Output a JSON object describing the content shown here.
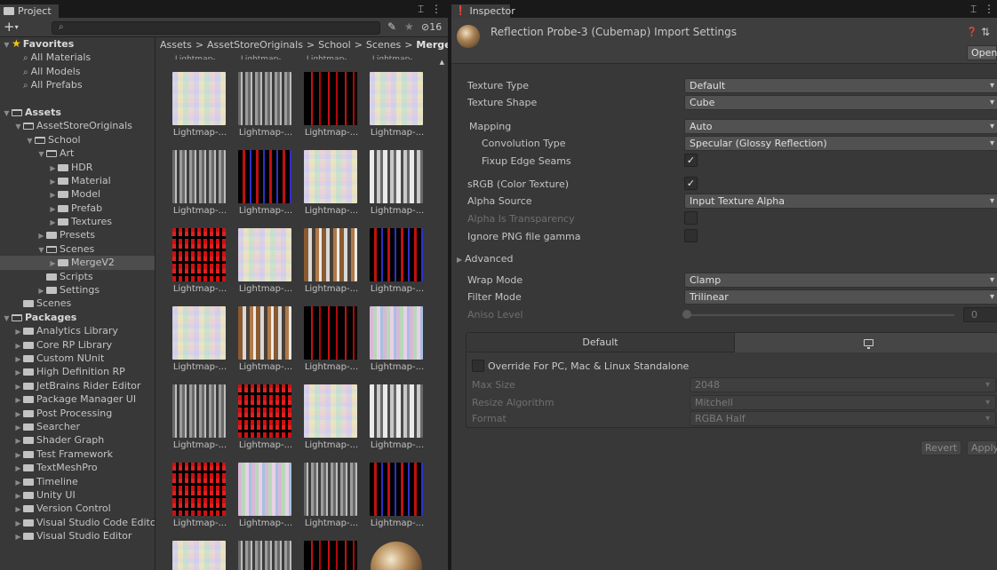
{
  "project": {
    "tab_label": "Project",
    "tab_menu": "⌶ ⋮",
    "toolbar": {
      "plus_label": "+",
      "plus_caret": "▾",
      "search_placeholder": "",
      "search_icon": "⌕",
      "hidden_count": "16"
    },
    "tree": [
      {
        "label": "Favorites",
        "level": 0,
        "kind": "favorites",
        "arrow": "▼",
        "bold": true
      },
      {
        "label": "All Materials",
        "level": 1,
        "kind": "search"
      },
      {
        "label": "All Models",
        "level": 1,
        "kind": "search"
      },
      {
        "label": "All Prefabs",
        "level": 1,
        "kind": "search"
      },
      {
        "label": "",
        "level": 0,
        "kind": "blank"
      },
      {
        "label": "Assets",
        "level": 0,
        "kind": "folder-open",
        "arrow": "▼",
        "bold": true
      },
      {
        "label": "AssetStoreOriginals",
        "level": 1,
        "kind": "folder-open",
        "arrow": "▼"
      },
      {
        "label": "School",
        "level": 2,
        "kind": "folder-open",
        "arrow": "▼"
      },
      {
        "label": "Art",
        "level": 3,
        "kind": "folder-open",
        "arrow": "▼"
      },
      {
        "label": "HDR",
        "level": 4,
        "kind": "folder",
        "arrow": "▶"
      },
      {
        "label": "Material",
        "level": 4,
        "kind": "folder",
        "arrow": "▶"
      },
      {
        "label": "Model",
        "level": 4,
        "kind": "folder",
        "arrow": "▶"
      },
      {
        "label": "Prefab",
        "level": 4,
        "kind": "folder",
        "arrow": "▶"
      },
      {
        "label": "Textures",
        "level": 4,
        "kind": "folder",
        "arrow": "▶"
      },
      {
        "label": "Presets",
        "level": 3,
        "kind": "folder",
        "arrow": "▶"
      },
      {
        "label": "Scenes",
        "level": 3,
        "kind": "folder-open",
        "arrow": "▼"
      },
      {
        "label": "MergeV2",
        "level": 4,
        "kind": "folder",
        "arrow": "▶",
        "selected": true
      },
      {
        "label": "Scripts",
        "level": 3,
        "kind": "folder"
      },
      {
        "label": "Settings",
        "level": 3,
        "kind": "folder",
        "arrow": "▶"
      },
      {
        "label": "Scenes",
        "level": 1,
        "kind": "folder"
      },
      {
        "label": "Packages",
        "level": 0,
        "kind": "folder-open",
        "arrow": "▼",
        "bold": true
      },
      {
        "label": "Analytics Library",
        "level": 1,
        "kind": "folder",
        "arrow": "▶"
      },
      {
        "label": "Core RP Library",
        "level": 1,
        "kind": "folder",
        "arrow": "▶"
      },
      {
        "label": "Custom NUnit",
        "level": 1,
        "kind": "folder",
        "arrow": "▶"
      },
      {
        "label": "High Definition RP",
        "level": 1,
        "kind": "folder",
        "arrow": "▶"
      },
      {
        "label": "JetBrains Rider Editor",
        "level": 1,
        "kind": "folder",
        "arrow": "▶"
      },
      {
        "label": "Package Manager UI",
        "level": 1,
        "kind": "folder",
        "arrow": "▶"
      },
      {
        "label": "Post Processing",
        "level": 1,
        "kind": "folder",
        "arrow": "▶"
      },
      {
        "label": "Searcher",
        "level": 1,
        "kind": "folder",
        "arrow": "▶"
      },
      {
        "label": "Shader Graph",
        "level": 1,
        "kind": "folder",
        "arrow": "▶"
      },
      {
        "label": "Test Framework",
        "level": 1,
        "kind": "folder",
        "arrow": "▶"
      },
      {
        "label": "TextMeshPro",
        "level": 1,
        "kind": "folder",
        "arrow": "▶"
      },
      {
        "label": "Timeline",
        "level": 1,
        "kind": "folder",
        "arrow": "▶"
      },
      {
        "label": "Unity UI",
        "level": 1,
        "kind": "folder",
        "arrow": "▶"
      },
      {
        "label": "Version Control",
        "level": 1,
        "kind": "folder",
        "arrow": "▶"
      },
      {
        "label": "Visual Studio Code Editc",
        "level": 1,
        "kind": "folder",
        "arrow": "▶"
      },
      {
        "label": "Visual Studio Editor",
        "level": 1,
        "kind": "folder",
        "arrow": "▶"
      }
    ],
    "breadcrumb": {
      "parts": [
        "Assets",
        "AssetStoreOriginals",
        "School",
        "Scenes"
      ],
      "separator": ">",
      "last": "Merge"
    },
    "top_cut_label": "Lightmap-...",
    "thumbnails": [
      {
        "label": "Lightmap-...",
        "texture": "pastel"
      },
      {
        "label": "Lightmap-...",
        "texture": "gray"
      },
      {
        "label": "Lightmap-...",
        "texture": "redsparse"
      },
      {
        "label": "Lightmap-...",
        "texture": "pastel"
      },
      {
        "label": "Lightmap-...",
        "texture": "gray"
      },
      {
        "label": "Lightmap-...",
        "texture": "blue"
      },
      {
        "label": "Lightmap-...",
        "texture": "pastel"
      },
      {
        "label": "Lightmap-...",
        "texture": "mix"
      },
      {
        "label": "Lightmap-...",
        "texture": "red"
      },
      {
        "label": "Lightmap-...",
        "texture": "pastel"
      },
      {
        "label": "Lightmap-...",
        "texture": "rust"
      },
      {
        "label": "Lightmap-...",
        "texture": "blue"
      },
      {
        "label": "Lightmap-...",
        "texture": "pastel"
      },
      {
        "label": "Lightmap-...",
        "texture": "rust"
      },
      {
        "label": "Lightmap-...",
        "texture": "redsparse"
      },
      {
        "label": "Lightmap-...",
        "texture": "pink"
      },
      {
        "label": "Lightmap-...",
        "texture": "gray"
      },
      {
        "label": "Lightmap-...",
        "texture": "red"
      },
      {
        "label": "Lightmap-...",
        "texture": "pastel"
      },
      {
        "label": "Lightmap-...",
        "texture": "mix"
      },
      {
        "label": "Lightmap-...",
        "texture": "red"
      },
      {
        "label": "Lightmap-...",
        "texture": "pink"
      },
      {
        "label": "Lightmap-...",
        "texture": "gray"
      },
      {
        "label": "Lightmap-...",
        "texture": "blue"
      },
      {
        "label": "",
        "texture": "pastel"
      },
      {
        "label": "",
        "texture": "gray"
      },
      {
        "label": "",
        "texture": "redsparse"
      },
      {
        "label": "",
        "texture": "sphere"
      }
    ]
  },
  "inspector": {
    "tab_label": "Inspector",
    "tab_menu": "⌶ ⋮",
    "title": "Reflection Probe-3 (Cubemap) Import Settings",
    "open_label": "Open",
    "properties": {
      "texture_type": {
        "label": "Texture Type",
        "value": "Default"
      },
      "texture_shape": {
        "label": "Texture Shape",
        "value": "Cube"
      },
      "mapping": {
        "label": "Mapping",
        "value": "Auto"
      },
      "convolution_type": {
        "label": "Convolution Type",
        "value": "Specular (Glossy Reflection)"
      },
      "fixup_edge_seams": {
        "label": "Fixup Edge Seams",
        "checked": true
      },
      "srgb": {
        "label": "sRGB (Color Texture)",
        "checked": true
      },
      "alpha_source": {
        "label": "Alpha Source",
        "value": "Input Texture Alpha"
      },
      "alpha_is_transparency": {
        "label": "Alpha Is Transparency",
        "checked": false,
        "disabled": true
      },
      "ignore_png_gamma": {
        "label": "Ignore PNG file gamma",
        "checked": false
      },
      "advanced": {
        "label": "Advanced",
        "expanded": false
      },
      "wrap_mode": {
        "label": "Wrap Mode",
        "value": "Clamp"
      },
      "filter_mode": {
        "label": "Filter Mode",
        "value": "Trilinear"
      },
      "aniso_level": {
        "label": "Aniso Level",
        "value": "0",
        "disabled": true
      }
    },
    "platform": {
      "default_tab": "Default",
      "pc_tab_icon": "monitor-icon",
      "override_label": "Override For PC, Mac & Linux Standalone",
      "max_size": {
        "label": "Max Size",
        "value": "2048"
      },
      "resize_algorithm": {
        "label": "Resize Algorithm",
        "value": "Mitchell"
      },
      "format": {
        "label": "Format",
        "value": "RGBA Half"
      }
    },
    "revert_label": "Revert",
    "apply_label": "Apply",
    "check_glyph": "✓"
  }
}
